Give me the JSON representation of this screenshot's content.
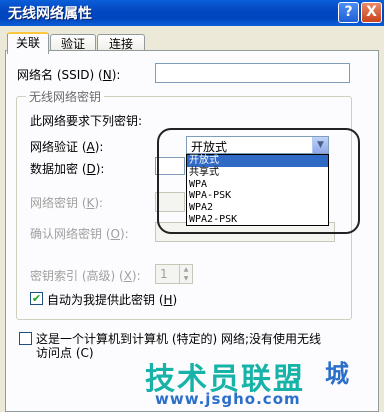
{
  "window": {
    "title": "无线网络属性",
    "help_label": "?",
    "close_label": "X"
  },
  "tabs": [
    {
      "label": "关联",
      "active": true
    },
    {
      "label": "验证",
      "active": false
    },
    {
      "label": "连接",
      "active": false
    }
  ],
  "ssid": {
    "label_prefix": "网络名 (SSID) (",
    "mnemonic": "N",
    "label_suffix": "):",
    "value": ""
  },
  "group": {
    "title": "无线网络密钥",
    "requirement_text": "此网络要求下列密钥:",
    "auth": {
      "label_prefix": "网络验证 (",
      "mnemonic": "A",
      "label_suffix": "):",
      "selected": "开放式",
      "options": [
        "开放式",
        "共享式",
        "WPA",
        "WPA-PSK",
        "WPA2",
        "WPA2-PSK"
      ]
    },
    "encryption": {
      "label_prefix": "数据加密 (",
      "mnemonic": "D",
      "label_suffix": "):"
    },
    "network_key": {
      "label_prefix": "网络密钥 (",
      "mnemonic": "K",
      "label_suffix": "):",
      "value": ""
    },
    "confirm_key": {
      "label_prefix": "确认网络密钥 (",
      "mnemonic": "O",
      "label_suffix": "):",
      "value": ""
    },
    "key_index": {
      "label_prefix": "密钥索引 (高级) (",
      "mnemonic": "X",
      "label_suffix": "):",
      "value": "1"
    },
    "auto_key": {
      "label_prefix": "自动为我提供此密钥 (",
      "mnemonic": "H",
      "label_suffix": ")",
      "checked": true
    }
  },
  "adhoc": {
    "line1": "这是一个计算机到计算机 (特定的) 网络;没有使用无线",
    "line2": "访问点 (C)",
    "checked": false
  },
  "watermark": {
    "main": "技术员联盟",
    "side": "城",
    "url": "www.jsgho.com"
  },
  "colors": {
    "title_bar": "#0a5fd8",
    "selection": "#316ac5",
    "watermark": "#18b3a8"
  }
}
